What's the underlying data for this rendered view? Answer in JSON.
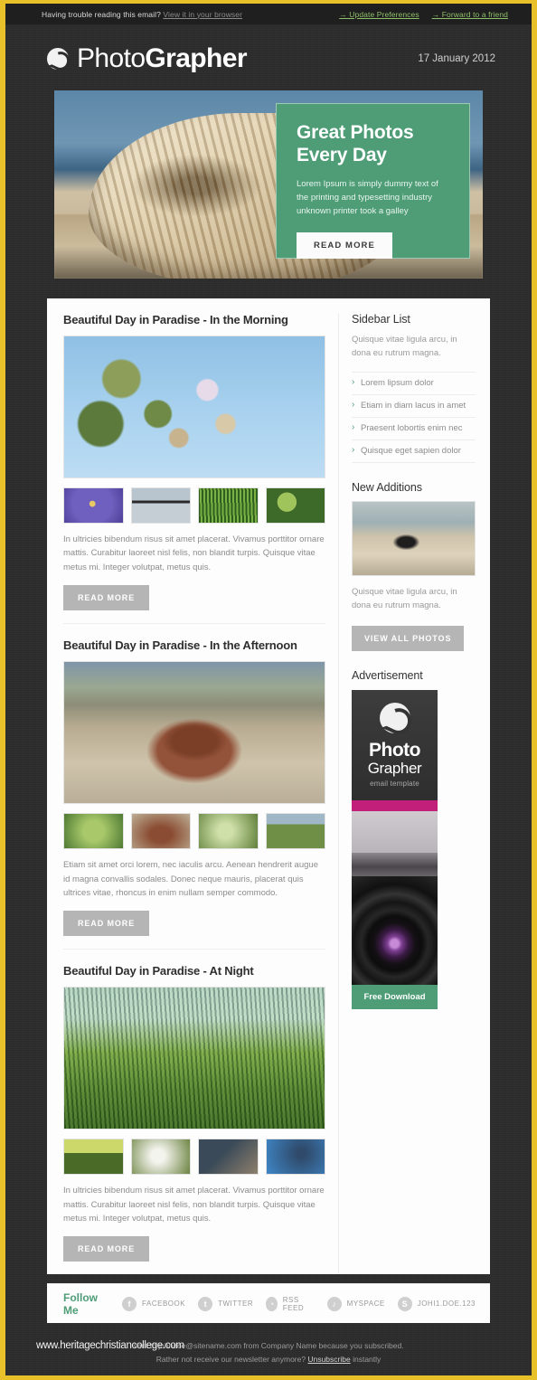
{
  "preheader": {
    "trouble_text": "Having trouble reading this email?",
    "view_link": "View it in your browser",
    "update_link": "→ Update Preferences",
    "forward_link": "→ Forward to a friend"
  },
  "header": {
    "logo_light": "Photo",
    "logo_bold": "Grapher",
    "date": "17 January 2012"
  },
  "hero": {
    "title_line1": "Great Photos",
    "title_line2": "Every Day",
    "description": "Lorem Ipsum is simply dummy text of the printing and typesetting industry unknown printer took a galley",
    "button": "READ MORE"
  },
  "articles": [
    {
      "title": "Beautiful Day in Paradise - In the Morning",
      "body": "In ultricies bibendum risus sit amet placerat. Vivamus porttitor ornare mattis. Curabitur laoreet nisl felis, non blandit turpis. Quisque vitae metus mi. Integer volutpat, metus quis.",
      "button": "READ MORE"
    },
    {
      "title": "Beautiful Day in Paradise - In the Afternoon",
      "body": "Etiam sit amet orci lorem, nec iaculis arcu. Aenean hendrerit augue id magna convallis sodales. Donec neque mauris, placerat quis ultrices vitae, rhoncus in enim nullam semper commodo.",
      "button": "READ MORE"
    },
    {
      "title": "Beautiful Day in Paradise - At Night",
      "body": "In ultricies bibendum risus sit amet placerat. Vivamus porttitor ornare mattis. Curabitur laoreet nisl felis, non blandit turpis. Quisque vitae metus mi. Integer volutpat, metus quis.",
      "button": "READ MORE"
    }
  ],
  "sidebar": {
    "list_heading": "Sidebar List",
    "list_desc": "Quisque vitae ligula arcu, in dona  eu rutrum magna.",
    "list_items": [
      "Lorem lipsum dolor",
      "Etiam in diam lacus in amet",
      "Praesent lobortis enim nec",
      "Quisque eget sapien dolor"
    ],
    "new_heading": "New Additions",
    "new_desc": "Quisque vitae ligula arcu, in dona  eu rutrum magna.",
    "new_button": "VIEW ALL PHOTOS",
    "ad_heading": "Advertisement",
    "ad_line1": "Photo",
    "ad_line2": "Grapher",
    "ad_line3": "email template",
    "ad_button": "Free Download"
  },
  "follow": {
    "label": "Follow Me",
    "items": [
      {
        "icon": "facebook-icon",
        "glyph": "f",
        "label": "FACEBOOK"
      },
      {
        "icon": "twitter-icon",
        "glyph": "t",
        "label": "TWITTER"
      },
      {
        "icon": "rss-icon",
        "glyph": "◔",
        "label": "RSS FEED"
      },
      {
        "icon": "myspace-icon",
        "glyph": "♪",
        "label": "MYSPACE"
      },
      {
        "icon": "skype-icon",
        "glyph": "S",
        "label": "JOHI1.DOE.123"
      }
    ]
  },
  "footer": {
    "line1": "sent to johndoe@sitename.com from Company Name because you subscribed.",
    "line2_pre": "Rather not receive our newsletter anymore?",
    "line2_link": "Unsubscribe",
    "line2_post": "instantly",
    "watermark": "www.heritagechristiancollege.com"
  },
  "colors": {
    "accent_green": "#4e9d77",
    "frame_gold": "#e8c12a",
    "ad_magenta": "#c21f7a",
    "button_grey": "#b5b5b5"
  }
}
